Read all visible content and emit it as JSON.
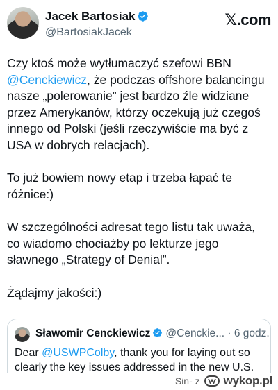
{
  "author": {
    "name": "Jacek Bartosiak",
    "handle": "@BartosiakJacek",
    "verified_color": "#1d9bf0"
  },
  "site_label": "𝕏.com",
  "tweet": {
    "p1_before": "Czy ktoś może wytłumaczyć szefowi BBN ",
    "p1_mention": "@Cenckiewicz",
    "p1_after": ", że podczas offshore balancingu nasze „polerowanie” jest bardzo źle widziane przez Amerykanów, którzy oczekują już czegoś innego od Polski (jeśli rzeczywiście ma być z USA w dobrych relacjach).",
    "p2": "To już bowiem nowy etap i trzeba łapać te różnice:)",
    "p3": "W szczególności adresat tego listu tak uważa, co wiadomo chociażby po lekturze jego sławnego „Strategy of Denial”.",
    "p4": "Żądajmy jakości:)"
  },
  "quote": {
    "name": "Sławomir Cenckiewicz",
    "handle": "@Cenckie...",
    "time": "· 6 godz.",
    "text_before": "Dear ",
    "text_mention": "@USWPColby",
    "text_after": ", thank you for laying out so clearly the key issues addressed in the new U.S."
  },
  "watermark": {
    "user": "Sin- z",
    "brand": "wykop.pl"
  },
  "colors": {
    "accent": "#1d9bf0",
    "text": "#0f1419",
    "secondary": "#536471"
  }
}
